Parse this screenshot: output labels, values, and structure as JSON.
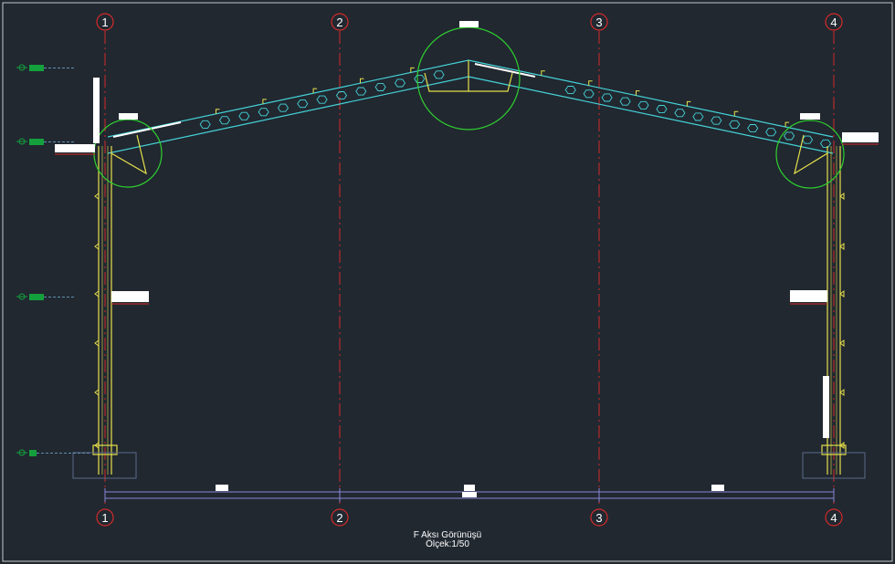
{
  "drawing": {
    "title": "F Aksı Görünüşü",
    "scale": "Ölçek:1/50",
    "axis_labels": [
      "1",
      "2",
      "3",
      "4"
    ]
  },
  "colors": {
    "background": "#212830",
    "frame": "#c8c8c8",
    "axis_line": "#d42a2a",
    "truss": "#45d3d8",
    "steel": "#e6e04a",
    "detail_circle": "#2fd02f",
    "dimension": "#8c86d8",
    "level_marker": "#14a03c",
    "label_block": "#ffffff",
    "foundation": "#5a6a8a"
  }
}
